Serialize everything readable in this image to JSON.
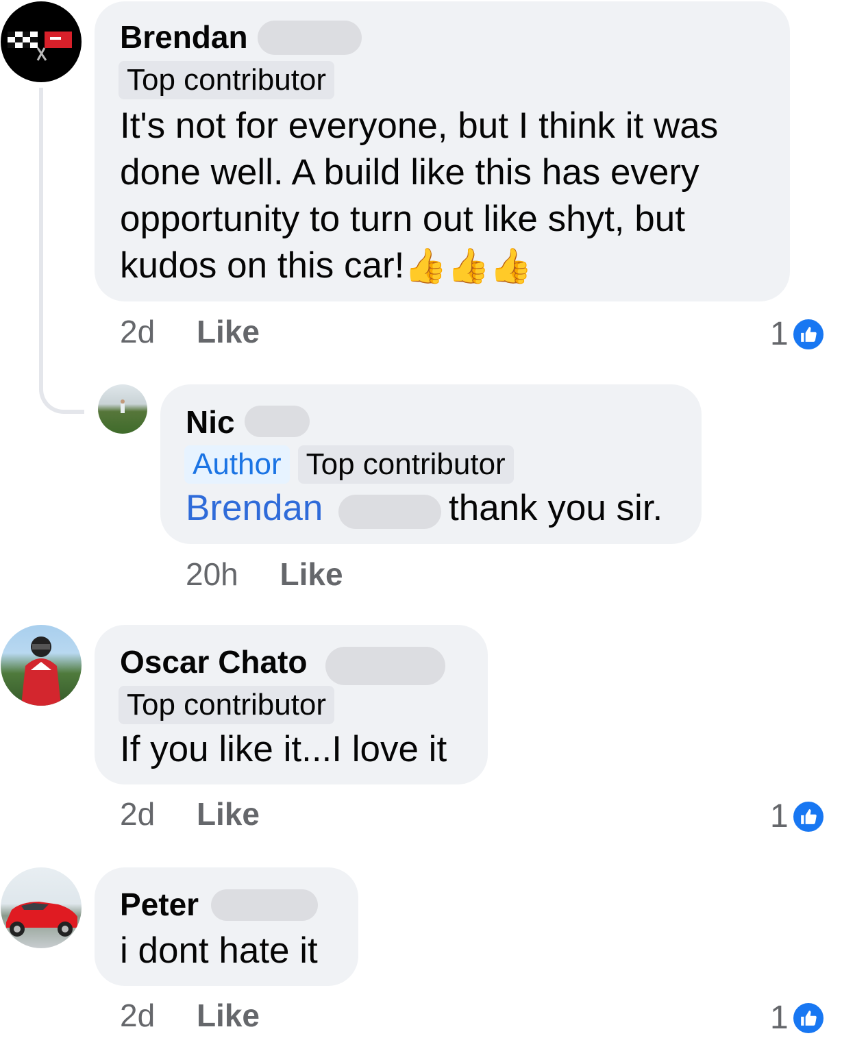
{
  "comments": [
    {
      "author": "Brendan",
      "badges": [
        "Top contributor"
      ],
      "text_lines": [
        "It's not for everyone, but I think it was",
        "done well. A build like this has every",
        "opportunity to turn out like shyt, but",
        "kudos on this car!"
      ],
      "emoji": "👍👍👍",
      "time": "2d",
      "like_label": "Like",
      "reaction_count": "1"
    },
    {
      "author": "Nic",
      "badges": [
        "Author",
        "Top contributor"
      ],
      "mention": "Brendan",
      "text": "thank you sir.",
      "time": "20h",
      "like_label": "Like"
    },
    {
      "author": "Oscar Chato",
      "badges": [
        "Top contributor"
      ],
      "text": "If you like it...I love it",
      "time": "2d",
      "like_label": "Like",
      "reaction_count": "1"
    },
    {
      "author": "Peter",
      "text": "i dont hate it",
      "time": "2d",
      "like_label": "Like",
      "reaction_count": "1"
    }
  ],
  "colors": {
    "bubble": "#f0f2f5",
    "badge": "#e4e6eb",
    "author_badge_text": "#1b74e4",
    "mention": "#2f6bd9",
    "like_reaction": "#1877f2",
    "meta_text": "#65676b"
  },
  "icons": {
    "reaction": "thumbs-up-icon"
  }
}
